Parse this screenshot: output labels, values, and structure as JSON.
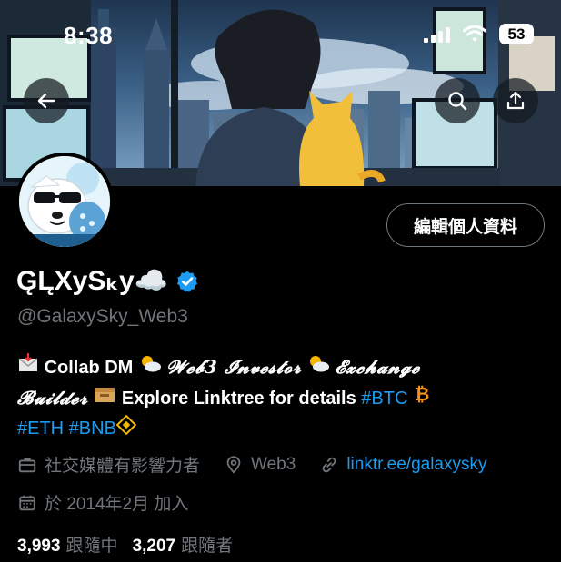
{
  "status_bar": {
    "time": "8:38",
    "battery": "53"
  },
  "header": {
    "back_icon": "back-arrow-icon",
    "search_icon": "search-icon",
    "share_icon": "share-icon"
  },
  "profile": {
    "edit_button": "編輯個人資料",
    "display_name": "G̨L̨XySₖy☁️",
    "handle": "@GalaxySky_Web3",
    "verified_color": "#1d9bf0",
    "bio": {
      "collab": "Collab DM",
      "web3_investor": "𝓦𝓮𝓫3 𝓘𝓷𝓿𝓮𝓼𝓽𝓸𝓻",
      "exchange": "𝓔𝔁𝓬𝓱𝓪𝓷𝓰𝓮",
      "builder": "𝓑𝓾𝓲𝓵𝓭𝓮𝓻",
      "linktree": "Explore Linktree for details",
      "tag_btc": "#BTC",
      "tag_eth": "#ETH",
      "tag_bnb": "#BNB"
    },
    "category": "社交媒體有影響力者",
    "location": "Web3",
    "website": "linktr.ee/galaxysky",
    "joined": "於 2014年2月 加入",
    "following_count": "3,993",
    "following_label": "跟隨中",
    "followers_count": "3,207",
    "followers_label": "跟隨者"
  },
  "colors": {
    "accent": "#1d9bf0",
    "muted": "#71767b",
    "background": "#000000"
  }
}
